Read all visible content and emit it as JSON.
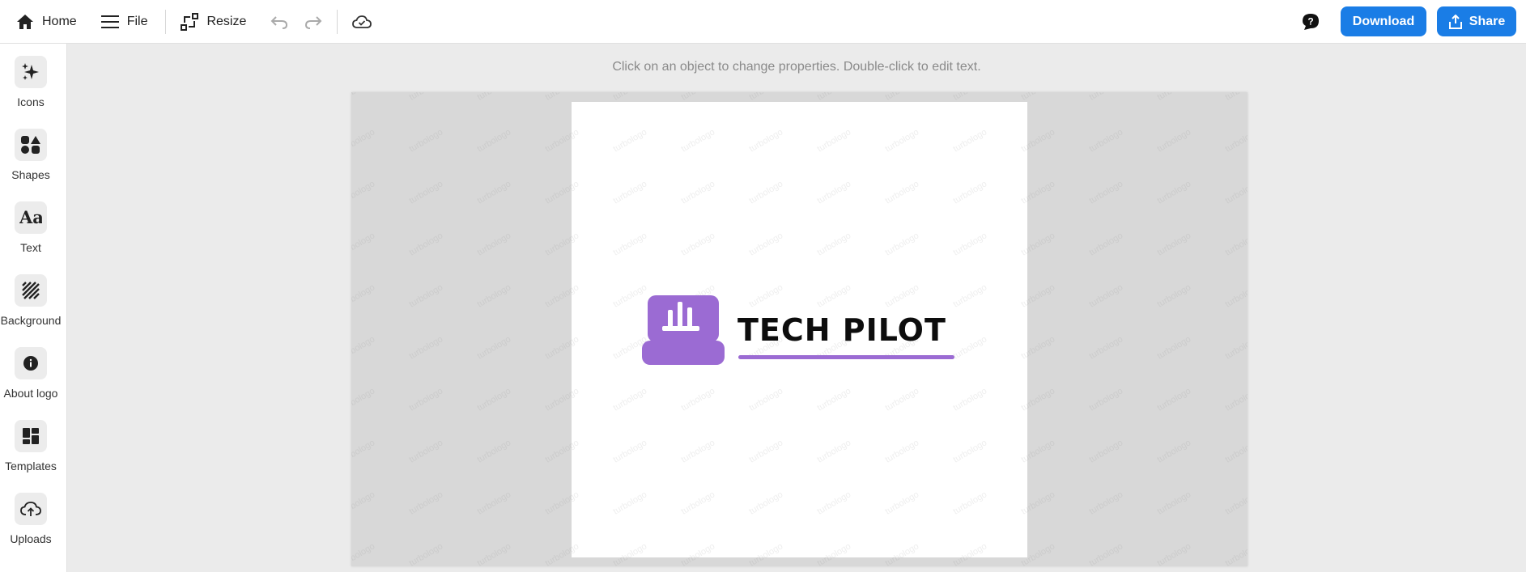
{
  "topbar": {
    "home_label": "Home",
    "file_label": "File",
    "resize_label": "Resize",
    "download_label": "Download",
    "share_label": "Share",
    "accent_color": "#1a7de6"
  },
  "sidebar": {
    "items": [
      {
        "label": "Icons",
        "icon": "sparkles-icon"
      },
      {
        "label": "Shapes",
        "icon": "shapes-icon"
      },
      {
        "label": "Text",
        "icon": "text-aa-icon"
      },
      {
        "label": "Background",
        "icon": "background-stripes-icon"
      },
      {
        "label": "About logo",
        "icon": "info-icon"
      },
      {
        "label": "Templates",
        "icon": "templates-grid-icon"
      },
      {
        "label": "Uploads",
        "icon": "cloud-upload-icon"
      }
    ]
  },
  "canvas": {
    "hint": "Click on an object to change properties. Double-click to edit text.",
    "watermark_text": "turbologo",
    "logo_text": "TECH PILOT",
    "logo_color": "#9b6bd3"
  }
}
